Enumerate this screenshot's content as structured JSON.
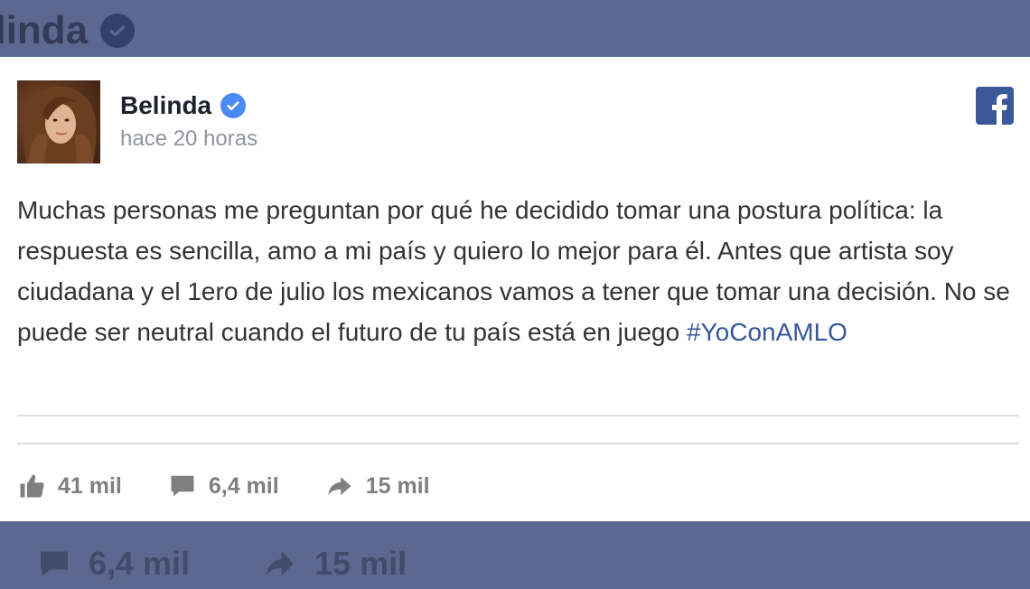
{
  "background": {
    "top_name": "elinda",
    "bottom_comments": "6,4 mil",
    "bottom_shares": "15 mil"
  },
  "post": {
    "author": "Belinda",
    "timestamp": "hace 20 horas",
    "text": "Muchas personas me preguntan por qué he decidido tomar una postura política: la respuesta es sencilla, amo a mi país y quiero lo mejor para él. Antes que artista soy ciudadana y el 1ero de julio los mexicanos vamos a tener que tomar una decisión. No se puede ser neutral cuando el futuro de tu país está en juego ",
    "hashtag": "#YoConAMLO"
  },
  "stats": {
    "likes": "41 mil",
    "comments": "6,4 mil",
    "shares": "15 mil"
  },
  "icons": {
    "verified": "verified-badge-icon",
    "platform": "facebook-icon",
    "like": "thumbs-up-icon",
    "comment": "comment-bubble-icon",
    "share": "share-arrow-icon"
  },
  "colors": {
    "background": "#5d6891",
    "card": "#ffffff",
    "verified": "#4a8af4",
    "facebook": "#3b5998",
    "hashtag": "#365899",
    "stats": "#7f7f7f"
  }
}
